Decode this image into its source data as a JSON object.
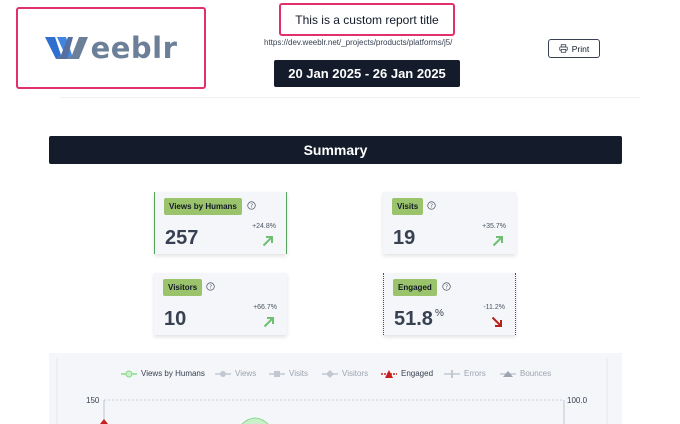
{
  "header": {
    "logo_text": "eeblr",
    "title": "This is a custom report title",
    "url": "https://dev.weeblr.net/_projects/products/platforms/j5/",
    "date_range": "20 Jan 2025 - 26 Jan 2025",
    "print_label": "Print"
  },
  "summary": {
    "title": "Summary"
  },
  "cards": [
    {
      "label": "Views by Humans",
      "value": "257",
      "unit": "",
      "change": "+24.8%",
      "trend": "up",
      "trend_color": "#6fbf73"
    },
    {
      "label": "Visits",
      "value": "19",
      "unit": "",
      "change": "+35.7%",
      "trend": "up",
      "trend_color": "#6fbf73"
    },
    {
      "label": "Visitors",
      "value": "10",
      "unit": "",
      "change": "+66.7%",
      "trend": "up",
      "trend_color": "#6fbf73"
    },
    {
      "label": "Engaged",
      "value": "51.8",
      "unit": "%",
      "change": "-11.2%",
      "trend": "down",
      "trend_color": "#b42318"
    }
  ],
  "chart": {
    "legend": [
      {
        "name": "Views by Humans",
        "active": true,
        "color": "#86d98a"
      },
      {
        "name": "Views",
        "active": false,
        "color": "#c2c8d2"
      },
      {
        "name": "Visits",
        "active": false,
        "color": "#c2c8d2"
      },
      {
        "name": "Visitors",
        "active": false,
        "color": "#c2c8d2"
      },
      {
        "name": "Engaged",
        "active": true,
        "color": "#c81e1e"
      },
      {
        "name": "Errors",
        "active": false,
        "color": "#c2c8d2"
      },
      {
        "name": "Bounces",
        "active": false,
        "color": "#c2c8d2"
      }
    ],
    "y_left_top": "150",
    "y_right_top": "100.0"
  },
  "colors": {
    "accent_border": "#e0306e",
    "dark_bar": "#141b2b",
    "label_bg": "#9bc36b",
    "logo_w": "#3a7bd5"
  }
}
